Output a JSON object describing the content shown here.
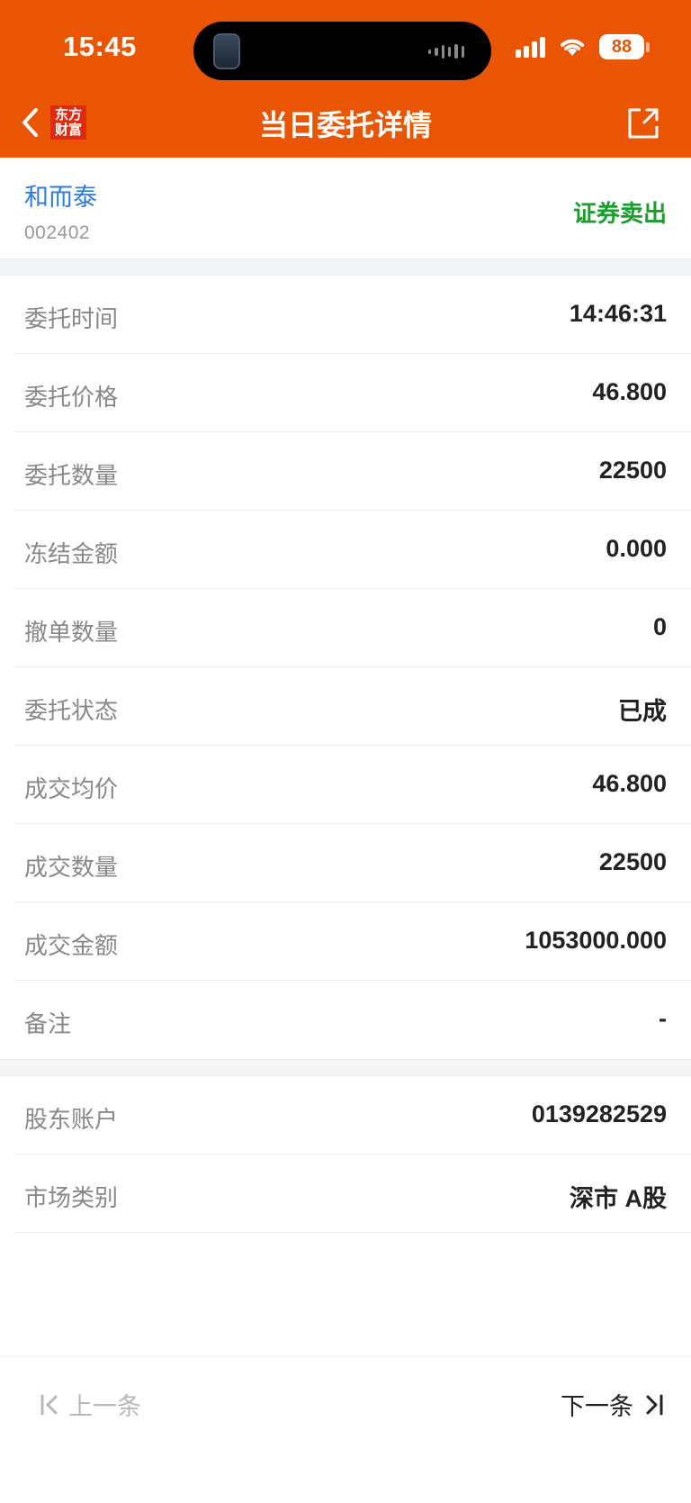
{
  "status_bar": {
    "time": "15:45",
    "battery": "88"
  },
  "header": {
    "title": "当日委托详情",
    "logo_line1": "东方",
    "logo_line2": "财富"
  },
  "stock": {
    "name": "和而泰",
    "code": "002402",
    "trade_type": "证券卖出"
  },
  "details": [
    {
      "label": "委托时间",
      "value": "14:46:31"
    },
    {
      "label": "委托价格",
      "value": "46.800"
    },
    {
      "label": "委托数量",
      "value": "22500"
    },
    {
      "label": "冻结金额",
      "value": "0.000"
    },
    {
      "label": "撤单数量",
      "value": "0"
    },
    {
      "label": "委托状态",
      "value": "已成"
    },
    {
      "label": "成交均价",
      "value": "46.800"
    },
    {
      "label": "成交数量",
      "value": "22500"
    },
    {
      "label": "成交金额",
      "value": "1053000.000"
    },
    {
      "label": "备注",
      "value": "-"
    }
  ],
  "account": [
    {
      "label": "股东账户",
      "value": "0139282529"
    },
    {
      "label": "市场类别",
      "value": "深市 A股"
    }
  ],
  "footer": {
    "prev_label": "上一条",
    "next_label": "下一条"
  },
  "colors": {
    "header": "#ea5504",
    "stock_name": "#2d7be0",
    "sell": "#1a9e2e"
  }
}
